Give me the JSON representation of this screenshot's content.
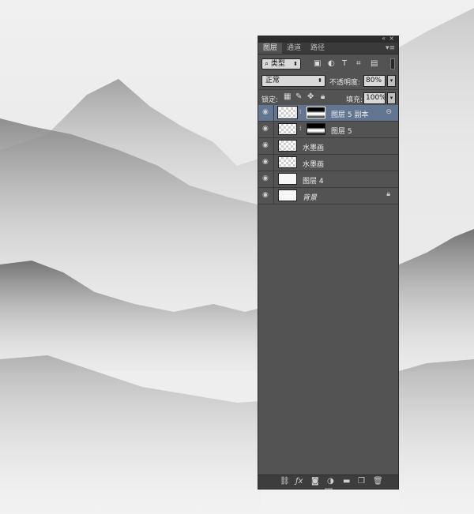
{
  "panel": {
    "topbar": {
      "collapse_glyph": "«",
      "close_glyph": "×"
    },
    "tabs": [
      {
        "label": "图层",
        "active": true
      },
      {
        "label": "通道",
        "active": false
      },
      {
        "label": "路径",
        "active": false
      }
    ],
    "menu_glyph": "▾≡",
    "filter": {
      "kind_label": "⌕ 类型",
      "icons": [
        "image-filter-icon",
        "adjustment-filter-icon",
        "type-filter-icon",
        "shape-filter-icon",
        "smart-object-filter-icon"
      ]
    },
    "blend_mode": "正常",
    "opacity_label": "不透明度:",
    "opacity_value": "80%",
    "lock_label": "锁定:",
    "fill_label": "填充:",
    "fill_value": "100%",
    "layers": [
      {
        "name": "图层 5 副本",
        "selected": true,
        "has_mask": true,
        "thumb": "transparent"
      },
      {
        "name": "图层 5",
        "selected": false,
        "has_mask": true,
        "thumb": "transparent"
      },
      {
        "name": "水墨画",
        "selected": false,
        "has_mask": false,
        "thumb": "transparent"
      },
      {
        "name": "水墨画",
        "selected": false,
        "has_mask": false,
        "thumb": "transparent"
      },
      {
        "name": "图层 4",
        "selected": false,
        "has_mask": false,
        "thumb": "solid"
      },
      {
        "name": "背景",
        "selected": false,
        "has_mask": false,
        "thumb": "solid",
        "locked": true
      }
    ]
  },
  "colors": {
    "panel_bg": "#535353",
    "selected_row": "#627692",
    "canvas_bg": "#efefef"
  }
}
